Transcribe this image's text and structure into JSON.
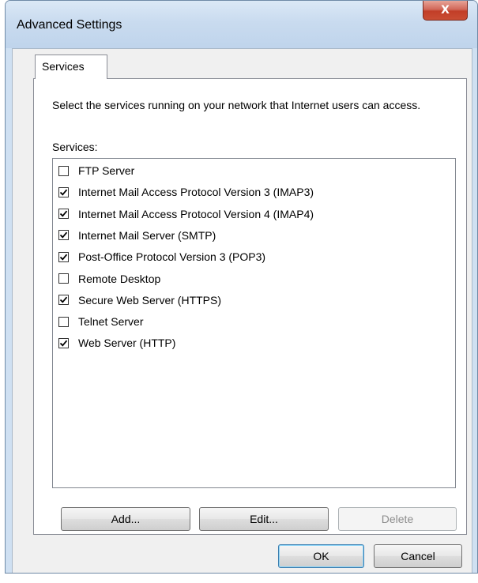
{
  "window": {
    "title": "Advanced Settings",
    "close_label": "X"
  },
  "tabs": [
    {
      "label": "Services",
      "selected": true
    }
  ],
  "services_tab": {
    "description": "Select the services running on your network that Internet users can access.",
    "list_label": "Services:",
    "items": [
      {
        "label": "FTP Server",
        "checked": false
      },
      {
        "label": "Internet Mail Access Protocol Version 3 (IMAP3)",
        "checked": true
      },
      {
        "label": "Internet Mail Access Protocol Version 4 (IMAP4)",
        "checked": true
      },
      {
        "label": "Internet Mail Server (SMTP)",
        "checked": true
      },
      {
        "label": "Post-Office Protocol Version 3 (POP3)",
        "checked": true
      },
      {
        "label": "Remote Desktop",
        "checked": false
      },
      {
        "label": "Secure Web Server (HTTPS)",
        "checked": true
      },
      {
        "label": "Telnet Server",
        "checked": false
      },
      {
        "label": "Web Server (HTTP)",
        "checked": true
      }
    ],
    "buttons": {
      "add": "Add...",
      "edit": "Edit...",
      "delete": "Delete"
    }
  },
  "dialog_buttons": {
    "ok": "OK",
    "cancel": "Cancel"
  },
  "icons": {
    "close": "close-icon",
    "checkmark": "checkmark-icon"
  },
  "colors": {
    "titlebar": "#c9dbef",
    "close_button": "#c94d33",
    "dialog_background": "#f0f0f0",
    "default_button_border": "#3c7fb1"
  }
}
